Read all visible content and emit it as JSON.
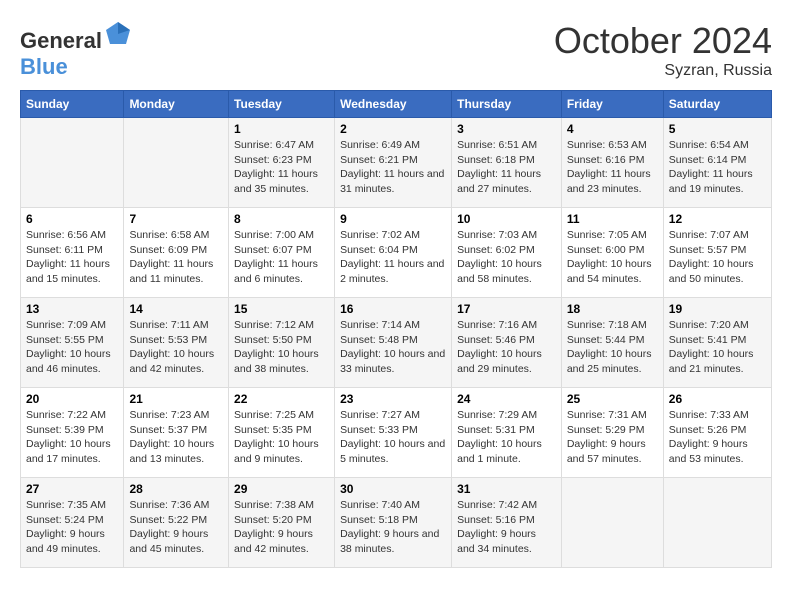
{
  "header": {
    "logo_general": "General",
    "logo_blue": "Blue",
    "month_year": "October 2024",
    "location": "Syzran, Russia"
  },
  "weekdays": [
    "Sunday",
    "Monday",
    "Tuesday",
    "Wednesday",
    "Thursday",
    "Friday",
    "Saturday"
  ],
  "weeks": [
    [
      {
        "day": "",
        "sunrise": "",
        "sunset": "",
        "daylight": ""
      },
      {
        "day": "",
        "sunrise": "",
        "sunset": "",
        "daylight": ""
      },
      {
        "day": "1",
        "sunrise": "Sunrise: 6:47 AM",
        "sunset": "Sunset: 6:23 PM",
        "daylight": "Daylight: 11 hours and 35 minutes."
      },
      {
        "day": "2",
        "sunrise": "Sunrise: 6:49 AM",
        "sunset": "Sunset: 6:21 PM",
        "daylight": "Daylight: 11 hours and 31 minutes."
      },
      {
        "day": "3",
        "sunrise": "Sunrise: 6:51 AM",
        "sunset": "Sunset: 6:18 PM",
        "daylight": "Daylight: 11 hours and 27 minutes."
      },
      {
        "day": "4",
        "sunrise": "Sunrise: 6:53 AM",
        "sunset": "Sunset: 6:16 PM",
        "daylight": "Daylight: 11 hours and 23 minutes."
      },
      {
        "day": "5",
        "sunrise": "Sunrise: 6:54 AM",
        "sunset": "Sunset: 6:14 PM",
        "daylight": "Daylight: 11 hours and 19 minutes."
      }
    ],
    [
      {
        "day": "6",
        "sunrise": "Sunrise: 6:56 AM",
        "sunset": "Sunset: 6:11 PM",
        "daylight": "Daylight: 11 hours and 15 minutes."
      },
      {
        "day": "7",
        "sunrise": "Sunrise: 6:58 AM",
        "sunset": "Sunset: 6:09 PM",
        "daylight": "Daylight: 11 hours and 11 minutes."
      },
      {
        "day": "8",
        "sunrise": "Sunrise: 7:00 AM",
        "sunset": "Sunset: 6:07 PM",
        "daylight": "Daylight: 11 hours and 6 minutes."
      },
      {
        "day": "9",
        "sunrise": "Sunrise: 7:02 AM",
        "sunset": "Sunset: 6:04 PM",
        "daylight": "Daylight: 11 hours and 2 minutes."
      },
      {
        "day": "10",
        "sunrise": "Sunrise: 7:03 AM",
        "sunset": "Sunset: 6:02 PM",
        "daylight": "Daylight: 10 hours and 58 minutes."
      },
      {
        "day": "11",
        "sunrise": "Sunrise: 7:05 AM",
        "sunset": "Sunset: 6:00 PM",
        "daylight": "Daylight: 10 hours and 54 minutes."
      },
      {
        "day": "12",
        "sunrise": "Sunrise: 7:07 AM",
        "sunset": "Sunset: 5:57 PM",
        "daylight": "Daylight: 10 hours and 50 minutes."
      }
    ],
    [
      {
        "day": "13",
        "sunrise": "Sunrise: 7:09 AM",
        "sunset": "Sunset: 5:55 PM",
        "daylight": "Daylight: 10 hours and 46 minutes."
      },
      {
        "day": "14",
        "sunrise": "Sunrise: 7:11 AM",
        "sunset": "Sunset: 5:53 PM",
        "daylight": "Daylight: 10 hours and 42 minutes."
      },
      {
        "day": "15",
        "sunrise": "Sunrise: 7:12 AM",
        "sunset": "Sunset: 5:50 PM",
        "daylight": "Daylight: 10 hours and 38 minutes."
      },
      {
        "day": "16",
        "sunrise": "Sunrise: 7:14 AM",
        "sunset": "Sunset: 5:48 PM",
        "daylight": "Daylight: 10 hours and 33 minutes."
      },
      {
        "day": "17",
        "sunrise": "Sunrise: 7:16 AM",
        "sunset": "Sunset: 5:46 PM",
        "daylight": "Daylight: 10 hours and 29 minutes."
      },
      {
        "day": "18",
        "sunrise": "Sunrise: 7:18 AM",
        "sunset": "Sunset: 5:44 PM",
        "daylight": "Daylight: 10 hours and 25 minutes."
      },
      {
        "day": "19",
        "sunrise": "Sunrise: 7:20 AM",
        "sunset": "Sunset: 5:41 PM",
        "daylight": "Daylight: 10 hours and 21 minutes."
      }
    ],
    [
      {
        "day": "20",
        "sunrise": "Sunrise: 7:22 AM",
        "sunset": "Sunset: 5:39 PM",
        "daylight": "Daylight: 10 hours and 17 minutes."
      },
      {
        "day": "21",
        "sunrise": "Sunrise: 7:23 AM",
        "sunset": "Sunset: 5:37 PM",
        "daylight": "Daylight: 10 hours and 13 minutes."
      },
      {
        "day": "22",
        "sunrise": "Sunrise: 7:25 AM",
        "sunset": "Sunset: 5:35 PM",
        "daylight": "Daylight: 10 hours and 9 minutes."
      },
      {
        "day": "23",
        "sunrise": "Sunrise: 7:27 AM",
        "sunset": "Sunset: 5:33 PM",
        "daylight": "Daylight: 10 hours and 5 minutes."
      },
      {
        "day": "24",
        "sunrise": "Sunrise: 7:29 AM",
        "sunset": "Sunset: 5:31 PM",
        "daylight": "Daylight: 10 hours and 1 minute."
      },
      {
        "day": "25",
        "sunrise": "Sunrise: 7:31 AM",
        "sunset": "Sunset: 5:29 PM",
        "daylight": "Daylight: 9 hours and 57 minutes."
      },
      {
        "day": "26",
        "sunrise": "Sunrise: 7:33 AM",
        "sunset": "Sunset: 5:26 PM",
        "daylight": "Daylight: 9 hours and 53 minutes."
      }
    ],
    [
      {
        "day": "27",
        "sunrise": "Sunrise: 7:35 AM",
        "sunset": "Sunset: 5:24 PM",
        "daylight": "Daylight: 9 hours and 49 minutes."
      },
      {
        "day": "28",
        "sunrise": "Sunrise: 7:36 AM",
        "sunset": "Sunset: 5:22 PM",
        "daylight": "Daylight: 9 hours and 45 minutes."
      },
      {
        "day": "29",
        "sunrise": "Sunrise: 7:38 AM",
        "sunset": "Sunset: 5:20 PM",
        "daylight": "Daylight: 9 hours and 42 minutes."
      },
      {
        "day": "30",
        "sunrise": "Sunrise: 7:40 AM",
        "sunset": "Sunset: 5:18 PM",
        "daylight": "Daylight: 9 hours and 38 minutes."
      },
      {
        "day": "31",
        "sunrise": "Sunrise: 7:42 AM",
        "sunset": "Sunset: 5:16 PM",
        "daylight": "Daylight: 9 hours and 34 minutes."
      },
      {
        "day": "",
        "sunrise": "",
        "sunset": "",
        "daylight": ""
      },
      {
        "day": "",
        "sunrise": "",
        "sunset": "",
        "daylight": ""
      }
    ]
  ]
}
